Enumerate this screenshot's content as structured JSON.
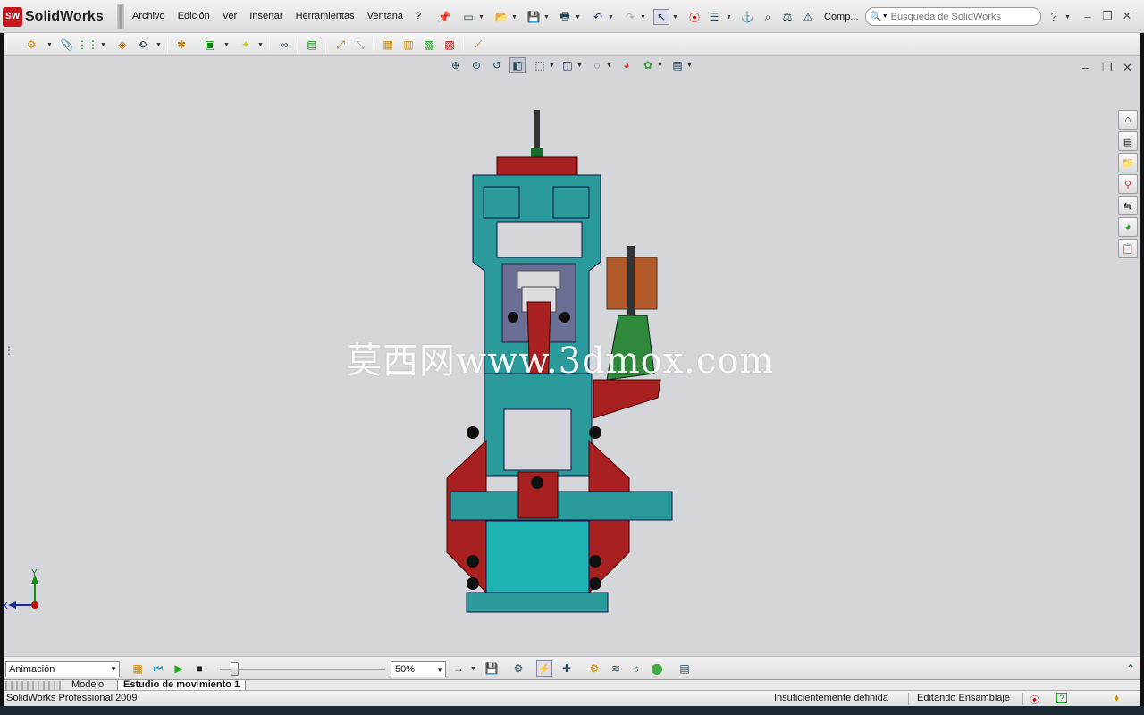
{
  "app": {
    "logo_badge": "SW",
    "logo_text": "SolidWorks"
  },
  "menu": [
    "Archivo",
    "Edición",
    "Ver",
    "Insertar",
    "Herramientas",
    "Ventana",
    "?"
  ],
  "toolbar": {
    "comp_label": "Comp...",
    "search_placeholder": "Búsqueda de SolidWorks"
  },
  "motion": {
    "study_type": "Animación",
    "zoom": "50%"
  },
  "tabs": [
    "Modelo",
    "Estudio de movimiento 1"
  ],
  "status": {
    "product": "SolidWorks Professional 2009",
    "definition": "Insuficientemente definida",
    "mode": "Editando Ensamblaje"
  },
  "watermark": "莫西网www.3dmox.com",
  "triad": {
    "y": "Y",
    "x": "X"
  },
  "colors": {
    "teal": "#2a9a9a",
    "dark_red": "#b02020",
    "bolt_blue": "#0a2a8a",
    "coil_brown": "#b35a2a",
    "green_bracket": "#2e8a3a",
    "viewport_bg": "#d4d6da"
  }
}
